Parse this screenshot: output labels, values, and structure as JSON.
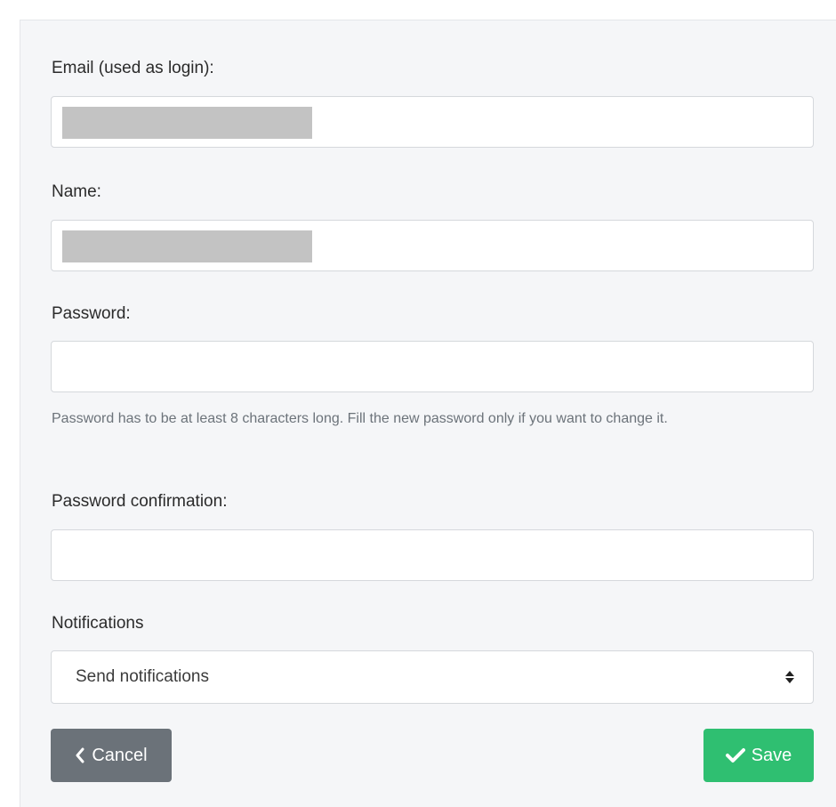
{
  "form": {
    "email": {
      "label": "Email (used as login):",
      "value": ""
    },
    "name": {
      "label": "Name:",
      "value": ""
    },
    "password": {
      "label": "Password:",
      "value": "",
      "help": "Password has to be at least 8 characters long. Fill the new password only if you want to change it."
    },
    "password_confirmation": {
      "label": "Password confirmation:",
      "value": ""
    },
    "notifications": {
      "label": "Notifications",
      "selected": "Send notifications"
    }
  },
  "actions": {
    "cancel_label": "Cancel",
    "save_label": "Save",
    "cancel_icon": "chevron-left-icon",
    "save_icon": "check-icon"
  },
  "colors": {
    "cancel_button": "#6b7279",
    "save_button": "#2fbf71",
    "panel_background": "#f5f6f8"
  }
}
